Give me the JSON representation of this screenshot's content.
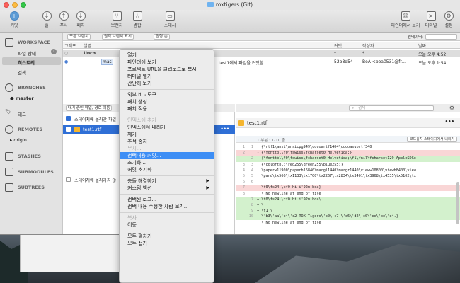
{
  "window": {
    "title": "roxtigers (Git)"
  },
  "toolbar": {
    "commit": "커밋",
    "pull": "풀",
    "push": "푸시",
    "fetch": "패치",
    "branch": "브랜치",
    "merge": "병합",
    "stash": "스태시",
    "show_in_finder": "파인더에서 보기",
    "terminal": "터미널",
    "settings": "설정"
  },
  "filterbar": {
    "branches": "모든 브랜치",
    "remote": "원격 브랜치 표시",
    "order": "원형 순",
    "jump": "컨테이버:"
  },
  "sidebar": {
    "workspace": "WORKSPACE",
    "file_status": "파일 상태",
    "file_status_badge": "1",
    "history": "히스토리",
    "search": "검색",
    "branches": "BRANCHES",
    "master": "master",
    "tags": "태그",
    "remotes": "REMOTES",
    "origin": "origin",
    "stashes": "STASHES",
    "submodules": "SUBMODULES",
    "subtrees": "SUBTREES"
  },
  "history": {
    "headers": {
      "graph": "그래프",
      "description": "설명",
      "commit": "커밋",
      "author": "작성자",
      "date": "날짜"
    },
    "rows": [
      {
        "description": "Unco",
        "commit": "*",
        "author": "*",
        "date": "오늘 오후 4:52"
      },
      {
        "branch": "mas",
        "description": "test1에서 파일을 커밋함.",
        "commit": "52b8d54",
        "author": "BoA <boa0531@fr...",
        "date": "오늘 오후 1:54"
      }
    ]
  },
  "files": {
    "toolbar_label": "대기 중인 파일, 경로 이름",
    "staged_header": "스테이지에 올라간 파일",
    "file_name": "test1.rtf",
    "unstaged_header": "스테이지에 올라가지 않"
  },
  "diff": {
    "search_placeholder": "검색",
    "file_name": "test1.rtf",
    "hunk1": "1 부분 : 1-10 줄",
    "hunk1_button": "코드뭉치 스테이지에서 내리기",
    "lines": [
      {
        "n1": "1",
        "n2": "1",
        "kind": "ctx",
        "text": "  {\\rtf1\\ansi\\ansicpg949\\cocoartf1404\\cocoasubrtf340"
      },
      {
        "n1": "2",
        "n2": "",
        "kind": "del",
        "text": "- {\\fonttbl\\f0\\fswiss\\fcharset0 Helvetica;}"
      },
      {
        "n1": "",
        "n2": "2",
        "kind": "add",
        "text": "+ {\\fonttbl\\f0\\fswiss\\fcharset0 Helvetica;\\f1\\fnil\\fcharset129 AppleSDGo"
      },
      {
        "n1": "3",
        "n2": "3",
        "kind": "ctx",
        "text": "  {\\colortbl;\\red255\\green255\\blue255;}"
      },
      {
        "n1": "4",
        "n2": "4",
        "kind": "ctx",
        "text": "  \\paperw11900\\paperh16840\\margl1440\\margr1440\\vieww10800\\viewh8400\\view"
      },
      {
        "n1": "5",
        "n2": "5",
        "kind": "ctx",
        "text": "  \\pard\\tx566\\tx1133\\tx1700\\tx2267\\tx2834\\tx3401\\tx3968\\tx4535\\tx5102\\tx"
      },
      {
        "n1": "6",
        "n2": "6",
        "kind": "ctx",
        "text": ""
      },
      {
        "n1": "7",
        "n2": "",
        "kind": "del",
        "text": "- \\f0\\fs24 \\cf0 hi i'92m boa}"
      },
      {
        "n1": "8",
        "n2": "",
        "kind": "ctx",
        "text": "  \\ No newline at end of file"
      },
      {
        "n1": "",
        "n2": "7",
        "kind": "add",
        "text": "+ \\f0\\fs24 \\cf0 hi i'92m boa\\"
      },
      {
        "n1": "",
        "n2": "8",
        "kind": "add",
        "text": "+ \\"
      },
      {
        "n1": "",
        "n2": "9",
        "kind": "add",
        "text": "+ \\f1 \\"
      },
      {
        "n1": "",
        "n2": "10",
        "kind": "add",
        "text": "+ \\'b3\\'aa\\'b4\\'c2 ROX Tigers\\'c0\\'c7 \\'c6\\'d2\\'c0\\'cc\\'be\\'e4.}"
      },
      {
        "n1": "",
        "n2": "",
        "kind": "ctx",
        "text": "  \\ No newline at end of file"
      }
    ]
  },
  "context_menu": {
    "items": [
      {
        "label": "열기",
        "disabled": false
      },
      {
        "label": "파인더에 보기",
        "disabled": false
      },
      {
        "label": "프로젝트 URL을 클립보드로 복사",
        "disabled": false
      },
      {
        "label": "터미널 열기",
        "disabled": false
      },
      {
        "label": "간단히 보기",
        "disabled": false
      },
      {
        "sep": true
      },
      {
        "label": "외부 비교도구",
        "disabled": false
      },
      {
        "label": "패치 생성...",
        "disabled": false
      },
      {
        "label": "패치 적용...",
        "disabled": false
      },
      {
        "sep": true
      },
      {
        "label": "인덱스에 추가",
        "disabled": true
      },
      {
        "label": "인덱스에서 내리기",
        "disabled": false
      },
      {
        "label": "제거",
        "disabled": false
      },
      {
        "label": "추적 중지",
        "disabled": false
      },
      {
        "label": "무시...",
        "disabled": true
      },
      {
        "label": "선택내용 커밋...",
        "disabled": false,
        "highlight": true
      },
      {
        "label": "초기화...",
        "disabled": false
      },
      {
        "label": "커밋 초기화...",
        "disabled": false
      },
      {
        "sep": true
      },
      {
        "label": "충돌 해결하기",
        "disabled": false,
        "submenu": true
      },
      {
        "label": "커스텀 액션",
        "disabled": false,
        "submenu": true
      },
      {
        "sep": true
      },
      {
        "label": "선택된 로그...",
        "disabled": false
      },
      {
        "label": "선택 내용 수정한 사람 보기...",
        "disabled": false
      },
      {
        "sep": true
      },
      {
        "label": "복사...",
        "disabled": true
      },
      {
        "label": "이동...",
        "disabled": false
      },
      {
        "sep": true
      },
      {
        "label": "모두 펼치기",
        "disabled": false
      },
      {
        "label": "모두 접기",
        "disabled": false
      }
    ]
  },
  "colors": {
    "selection": "#2f6fd6",
    "menu_highlight": "#3d8ef5",
    "added": "#d3f1cd",
    "removed": "#f9d6d6"
  }
}
